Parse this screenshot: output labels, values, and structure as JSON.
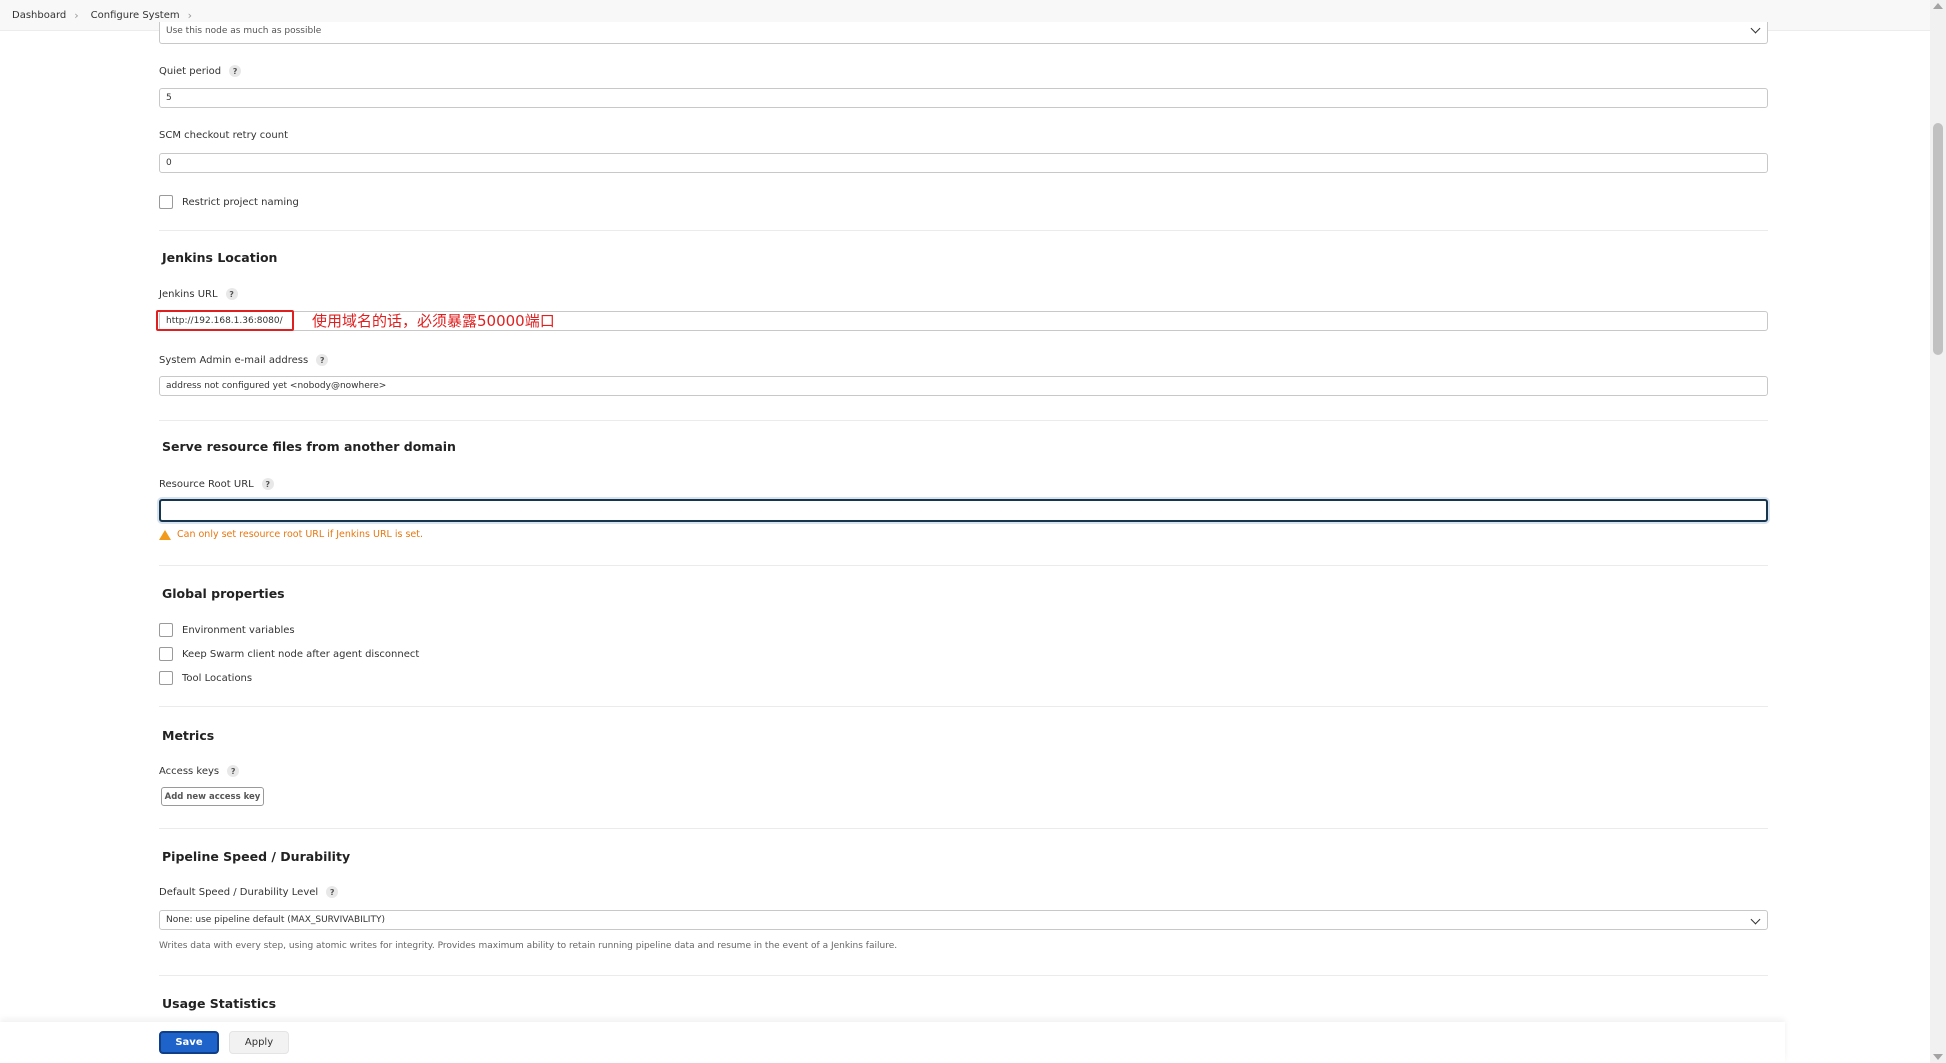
{
  "breadcrumb": {
    "items": [
      "Dashboard",
      "Configure System"
    ],
    "separator": "›"
  },
  "usage": {
    "value": "Use this node as much as possible"
  },
  "quiet_period": {
    "label": "Quiet period",
    "value": "5"
  },
  "scm_retry": {
    "label": "SCM checkout retry count",
    "value": "0"
  },
  "restrict_naming": {
    "label": "Restrict project naming"
  },
  "jenkins_location": {
    "title": "Jenkins Location",
    "url_label": "Jenkins URL",
    "url_value": "http://192.168.1.36:8080/",
    "email_label": "System Admin e-mail address",
    "email_value": "address not configured yet <nobody@nowhere>"
  },
  "annotation": {
    "text": "使用域名的话，必须暴露50000端口",
    "color": "#e02020"
  },
  "resource_domain": {
    "title": "Serve resource files from another domain",
    "root_url_label": "Resource Root URL",
    "root_url_value": "",
    "warning": "Can only set resource root URL if Jenkins URL is set."
  },
  "global_properties": {
    "title": "Global properties",
    "items": [
      "Environment variables",
      "Keep Swarm client node after agent disconnect",
      "Tool Locations"
    ]
  },
  "metrics": {
    "title": "Metrics",
    "access_keys_label": "Access keys",
    "add_key_button": "Add new access key"
  },
  "pipeline": {
    "title": "Pipeline Speed / Durability",
    "level_label": "Default Speed / Durability Level",
    "level_value": "None: use pipeline default (MAX_SURVIVABILITY)",
    "description": "Writes data with every step, using atomic writes for integrity.  Provides maximum ability to retain running pipeline data and resume in the event of a Jenkins failure."
  },
  "usage_statistics": {
    "title": "Usage Statistics"
  },
  "footer": {
    "save": "Save",
    "apply": "Apply"
  },
  "help_glyph": "?",
  "colors": {
    "primary": "#1d63c9",
    "warning": "#e8770f",
    "annotation": "#e02020"
  }
}
